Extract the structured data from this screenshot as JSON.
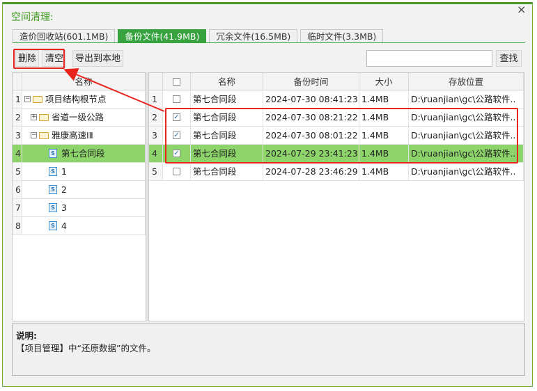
{
  "window": {
    "title": "空间清理:",
    "close_glyph": "×"
  },
  "tabs": [
    {
      "label": "造价回收站(601.1MB)",
      "active": false
    },
    {
      "label": "备份文件(41.9MB)",
      "active": true
    },
    {
      "label": "冗余文件(16.5MB)",
      "active": false
    },
    {
      "label": "临时文件(3.3MB)",
      "active": false
    }
  ],
  "toolbar": {
    "delete_label": "删除",
    "clear_label": "清空",
    "export_label": "导出到本地",
    "search_label": "查找",
    "search_value": ""
  },
  "tree": {
    "header": "名称",
    "rows": [
      {
        "num": "1",
        "expander": "⊟",
        "icon": "folder-icon",
        "label": "项目结构根节点"
      },
      {
        "num": "2",
        "expander": "⊞",
        "icon": "folder-icon",
        "label": "省道一级公路"
      },
      {
        "num": "3",
        "expander": "⊟",
        "icon": "folder-icon",
        "label": "雅康高速ⅠⅡ"
      },
      {
        "num": "4",
        "expander": "",
        "icon": "document-icon",
        "label": "第七合同段",
        "selected": true
      },
      {
        "num": "5",
        "expander": "",
        "icon": "document-icon",
        "label": "1"
      },
      {
        "num": "6",
        "expander": "",
        "icon": "document-icon",
        "label": "2"
      },
      {
        "num": "7",
        "expander": "",
        "icon": "document-icon",
        "label": "3"
      },
      {
        "num": "8",
        "expander": "",
        "icon": "document-icon",
        "label": "4"
      }
    ]
  },
  "table": {
    "headers": {
      "name": "名称",
      "time": "备份时间",
      "size": "大小",
      "location": "存放位置"
    },
    "rows": [
      {
        "num": "1",
        "checked": false,
        "name": "第七合同段",
        "time": "2024-07-30 08:41:23",
        "size": "1.4MB",
        "location": "D:\\ruanjian\\gc\\公路软件..",
        "selected": false
      },
      {
        "num": "2",
        "checked": true,
        "name": "第七合同段",
        "time": "2024-07-30 08:21:22",
        "size": "1.4MB",
        "location": "D:\\ruanjian\\gc\\公路软件..",
        "selected": false
      },
      {
        "num": "3",
        "checked": true,
        "name": "第七合同段",
        "time": "2024-07-30 08:01:22",
        "size": "1.4MB",
        "location": "D:\\ruanjian\\gc\\公路软件..",
        "selected": false
      },
      {
        "num": "4",
        "checked": true,
        "name": "第七合同段",
        "time": "2024-07-29 23:41:23",
        "size": "1.4MB",
        "location": "D:\\ruanjian\\gc\\公路软件..",
        "selected": true
      },
      {
        "num": "5",
        "checked": false,
        "name": "第七合同段",
        "time": "2024-07-28 23:46:29",
        "size": "1.4MB",
        "location": "D:\\ruanjian\\gc\\公路软件..",
        "selected": false
      }
    ]
  },
  "description": {
    "title": "说明:",
    "text": "【项目管理】中“还原数据”的文件。"
  },
  "colors": {
    "accent": "#36a33e",
    "selected_row": "#8dd46a",
    "annotation": "#e8241c"
  }
}
